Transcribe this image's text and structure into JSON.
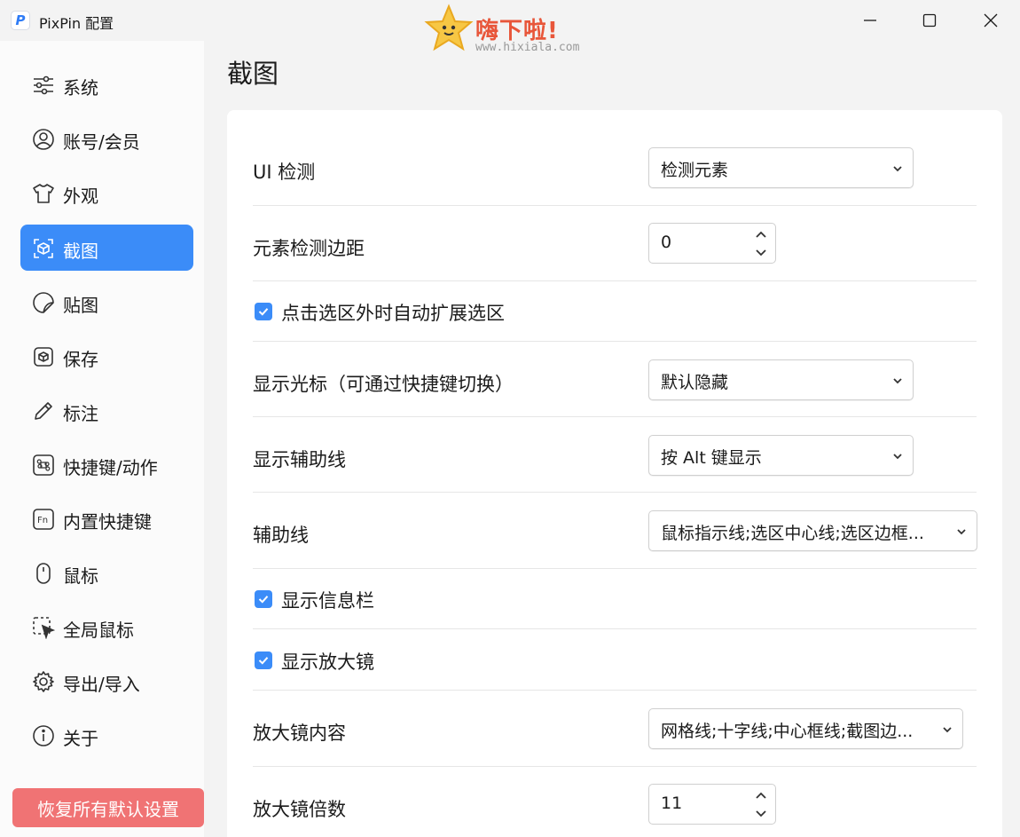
{
  "window": {
    "title": "PixPin 配置",
    "logo_letter": "P"
  },
  "watermark": {
    "text": "嗨下啦!",
    "url": "www.hixiala.com"
  },
  "sidebar": {
    "items": [
      {
        "label": "系统",
        "icon": "sliders-icon"
      },
      {
        "label": "账号/会员",
        "icon": "user-icon"
      },
      {
        "label": "外观",
        "icon": "shirt-icon"
      },
      {
        "label": "截图",
        "icon": "screenshot-icon",
        "active": true
      },
      {
        "label": "贴图",
        "icon": "sticker-icon"
      },
      {
        "label": "保存",
        "icon": "save-box-icon"
      },
      {
        "label": "标注",
        "icon": "pencil-icon"
      },
      {
        "label": "快捷键/动作",
        "icon": "command-icon"
      },
      {
        "label": "内置快捷键",
        "icon": "fn-key-icon"
      },
      {
        "label": "鼠标",
        "icon": "mouse-icon"
      },
      {
        "label": "全局鼠标",
        "icon": "cursor-select-icon"
      },
      {
        "label": "导出/导入",
        "icon": "gear-icon"
      },
      {
        "label": "关于",
        "icon": "info-icon"
      }
    ],
    "reset_label": "恢复所有默认设置"
  },
  "main": {
    "title": "截图",
    "settings": {
      "ui_detect": {
        "label": "UI 检测",
        "value": "检测元素"
      },
      "detect_margin": {
        "label": "元素检测边距",
        "value": "0"
      },
      "auto_expand": {
        "label": "点击选区外时自动扩展选区",
        "checked": true
      },
      "show_cursor": {
        "label": "显示光标（可通过快捷键切换）",
        "value": "默认隐藏"
      },
      "show_guides": {
        "label": "显示辅助线",
        "value": "按 Alt 键显示"
      },
      "guides": {
        "label": "辅助线",
        "value": "鼠标指示线;选区中心线;选区边框..."
      },
      "show_infobar": {
        "label": "显示信息栏",
        "checked": true
      },
      "show_magnifier": {
        "label": "显示放大镜",
        "checked": true
      },
      "magnifier_content": {
        "label": "放大镜内容",
        "value": "网格线;十字线;中心框线;截图边..."
      },
      "magnifier_scale": {
        "label": "放大镜倍数",
        "value": "11"
      }
    }
  },
  "colors": {
    "accent": "#3b8cf8",
    "reset": "#f07374",
    "background": "#f3f3f3",
    "card": "#ffffff"
  }
}
